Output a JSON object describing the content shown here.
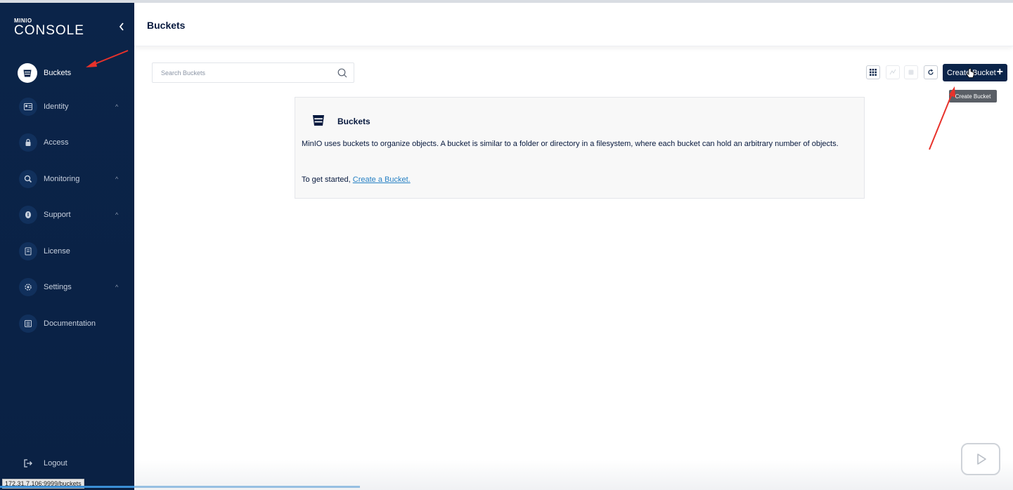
{
  "logo": {
    "small": "MINIO",
    "big": "CONSOLE"
  },
  "sidebar": {
    "collapse_icon": "chevron-left-icon",
    "items": [
      {
        "label": "Buckets",
        "icon": "bucket-icon",
        "active": true,
        "expandable": false
      },
      {
        "label": "Identity",
        "icon": "identity-icon",
        "active": false,
        "expandable": true
      },
      {
        "label": "Access",
        "icon": "lock-icon",
        "active": false,
        "expandable": false
      },
      {
        "label": "Monitoring",
        "icon": "monitoring-icon",
        "active": false,
        "expandable": true
      },
      {
        "label": "Support",
        "icon": "support-icon",
        "active": false,
        "expandable": true
      },
      {
        "label": "License",
        "icon": "license-icon",
        "active": false,
        "expandable": false
      },
      {
        "label": "Settings",
        "icon": "gear-icon",
        "active": false,
        "expandable": true
      },
      {
        "label": "Documentation",
        "icon": "documentation-icon",
        "active": false,
        "expandable": false
      }
    ],
    "expand_glyph": "^",
    "logout": {
      "label": "Logout",
      "icon": "logout-icon"
    }
  },
  "header": {
    "title": "Buckets"
  },
  "search": {
    "placeholder": "Search Buckets",
    "value": ""
  },
  "toolbar": {
    "create_label": "Create Bucket",
    "create_plus": "+",
    "tooltip": "Create Bucket"
  },
  "info": {
    "title": "Buckets",
    "text": "MinIO uses buckets to organize objects. A bucket is similar to a folder or directory in a filesystem, where each bucket can hold an arbitrary number of objects.",
    "start_prefix": "To get started, ",
    "start_link": "Create a Bucket."
  },
  "status_url": "172.31.7.106:9999/buckets",
  "colors": {
    "sidebar_bg": "#0b2449",
    "primary": "#0b2449",
    "link": "#2781c4",
    "annotation_arrow": "#e8322b"
  }
}
